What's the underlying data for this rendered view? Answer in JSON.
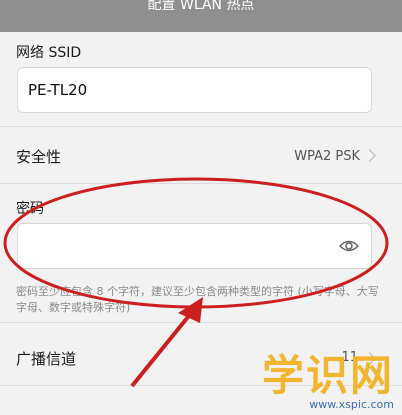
{
  "header": {
    "title": "配置 WLAN 热点"
  },
  "ssid": {
    "label": "网络 SSID",
    "value": "PE-TL20"
  },
  "security": {
    "label": "安全性",
    "value": "WPA2 PSK"
  },
  "password": {
    "label": "密码",
    "value": "",
    "hint": "密码至少应包含 8 个字符，建议至少包含两种类型的字符 (小写字母、大写字母、数字或特殊字符)"
  },
  "channel": {
    "label": "广播信道",
    "value": "11"
  },
  "watermark": {
    "text": "学识网",
    "url": "www.xspic.com"
  },
  "annotation": {
    "color": "#cc1f1f"
  }
}
